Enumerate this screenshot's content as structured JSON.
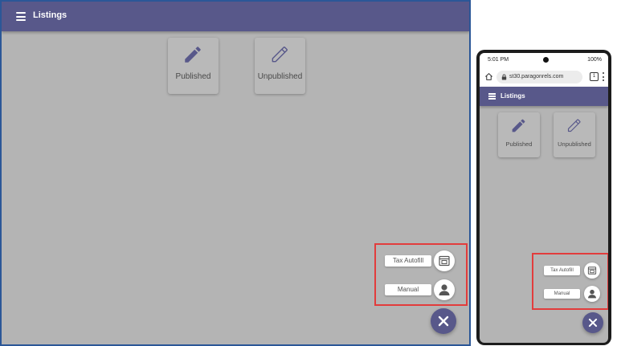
{
  "desktop": {
    "app_bar": {
      "title": "Listings"
    },
    "cards": [
      {
        "label": "Published",
        "icon": "pencil-filled-icon"
      },
      {
        "label": "Unpublished",
        "icon": "pencil-outline-icon"
      }
    ],
    "fab_menu": {
      "tax_autofill_label": "Tax Autofill",
      "manual_label": "Manual",
      "close_icon": "close-icon"
    }
  },
  "phone": {
    "status_bar": {
      "time": "5:01 PM",
      "battery": "100%"
    },
    "browser": {
      "url": "st30.paragonrels.com",
      "tab_count": "1"
    },
    "app_bar": {
      "title": "Listings"
    },
    "cards": [
      {
        "label": "Published",
        "icon": "pencil-filled-icon"
      },
      {
        "label": "Unpublished",
        "icon": "pencil-outline-icon"
      }
    ],
    "fab_menu": {
      "tax_autofill_label": "Tax Autofill",
      "manual_label": "Manual",
      "close_icon": "close-icon"
    }
  },
  "colors": {
    "app_bar": "#58588a",
    "overlay": "#b4b4b4",
    "highlight_box": "#e23c3c",
    "frame_border": "#2b5797"
  }
}
